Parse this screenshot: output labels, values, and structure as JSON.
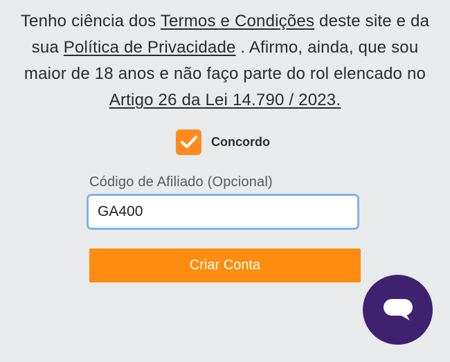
{
  "terms": {
    "part1": "Tenho ciência dos ",
    "terms_link": "Termos e Condições",
    "part2": " deste site e da sua ",
    "privacy_link": "Política de Privacidade",
    "part3": " . Afirmo, ainda, que sou maior de 18 anos e não faço parte do rol elencado no ",
    "law_link": "Artigo 26 da Lei 14.790 / 2023."
  },
  "agree": {
    "label": "Concordo",
    "checked": true,
    "color": "#ff8a1f"
  },
  "affiliate": {
    "label": "Código de Afiliado (Opcional)",
    "value": "GA400"
  },
  "submit": {
    "label": "Criar Conta",
    "color": "#ff8c0f"
  },
  "chat": {
    "icon": "chat-icon",
    "color": "#3e2270"
  }
}
